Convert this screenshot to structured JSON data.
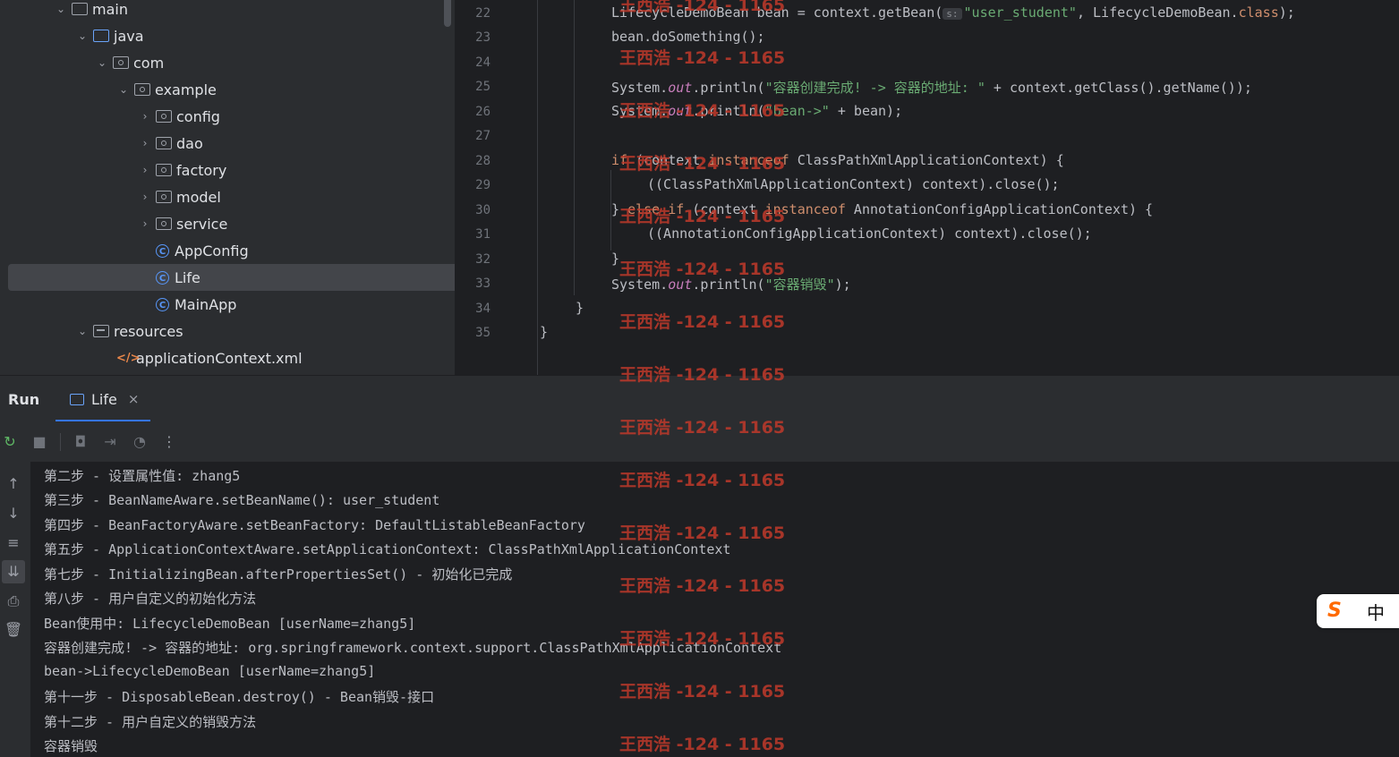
{
  "tree": {
    "items": [
      {
        "label": "main",
        "chev": "⌄",
        "icon": "folder"
      },
      {
        "label": "java",
        "chev": "⌄",
        "icon": "source-folder"
      },
      {
        "label": "com",
        "chev": "⌄",
        "icon": "package"
      },
      {
        "label": "example",
        "chev": "⌄",
        "icon": "package"
      },
      {
        "label": "config",
        "chev": "›",
        "icon": "package"
      },
      {
        "label": "dao",
        "chev": "›",
        "icon": "package"
      },
      {
        "label": "factory",
        "chev": "›",
        "icon": "package"
      },
      {
        "label": "model",
        "chev": "›",
        "icon": "package"
      },
      {
        "label": "service",
        "chev": "›",
        "icon": "package"
      },
      {
        "label": "AppConfig",
        "icon": "class"
      },
      {
        "label": "Life",
        "icon": "class"
      },
      {
        "label": "MainApp",
        "icon": "class"
      },
      {
        "label": "resources",
        "chev": "⌄",
        "icon": "resources-folder"
      },
      {
        "label": "applicationContext.xml",
        "icon": "xml-file"
      }
    ],
    "class_glyph": "C",
    "xml_glyph": "</>"
  },
  "editor": {
    "line_numbers": [
      "22",
      "23",
      "24",
      "25",
      "26",
      "27",
      "28",
      "29",
      "30",
      "31",
      "32",
      "33",
      "34",
      "35"
    ],
    "lines": {
      "l22a": "LifecycleDemoBean bean = context.getBean(",
      "l22hint": "s:",
      "l22str": "\"user_student\"",
      "l22b": ", LifecycleDemoBean.",
      "l22kw": "class",
      "l22c": ");",
      "l23": "bean.doSomething();",
      "l25a": "System.",
      "l25f": "out",
      "l25b": ".println(",
      "l25str": "\"容器创建完成! -> 容器的地址: \"",
      "l25c": " + context.getClass().getName());",
      "l26a": "System.",
      "l26f": "out",
      "l26b": ".println(",
      "l26str": "\"bean->\"",
      "l26c": " + bean);",
      "l28kw1": "if",
      "l28a": " (context ",
      "l28kw2": "instanceof",
      "l28b": " ClassPathXmlApplicationContext) {",
      "l29": "((ClassPathXmlApplicationContext) context).close();",
      "l30a": "} ",
      "l30kw1": "else if",
      "l30b": " (context ",
      "l30kw2": "instanceof",
      "l30c": " AnnotationConfigApplicationContext) {",
      "l31": "((AnnotationConfigApplicationContext) context).close();",
      "l32": "}",
      "l33a": "System.",
      "l33f": "out",
      "l33b": ".println(",
      "l33str": "\"容器销毁\"",
      "l33c": ");",
      "l34": "}",
      "l35": "}"
    }
  },
  "run": {
    "title": "Run",
    "tab_label": "Life",
    "tab_close": "×",
    "console_lines": [
      "第二步 - 设置属性值: zhang5",
      "第三步 - BeanNameAware.setBeanName(): user_student",
      "第四步 - BeanFactoryAware.setBeanFactory: DefaultListableBeanFactory",
      "第五步 - ApplicationContextAware.setApplicationContext: ClassPathXmlApplicationContext",
      "第七步 - InitializingBean.afterPropertiesSet() - 初始化已完成",
      "第八步 - 用户自定义的初始化方法",
      "Bean使用中: LifecycleDemoBean [userName=zhang5]",
      "容器创建完成! -> 容器的地址: org.springframework.context.support.ClassPathXmlApplicationContext",
      "bean->LifecycleDemoBean [userName=zhang5]",
      "第十一步 - DisposableBean.destroy() - Bean销毁-接口",
      "第十二步 - 用户自定义的销毁方法",
      "容器销毁"
    ]
  },
  "watermark": "王西浩 -124 - 1165",
  "ime": {
    "logo": "S",
    "mode": "中"
  }
}
